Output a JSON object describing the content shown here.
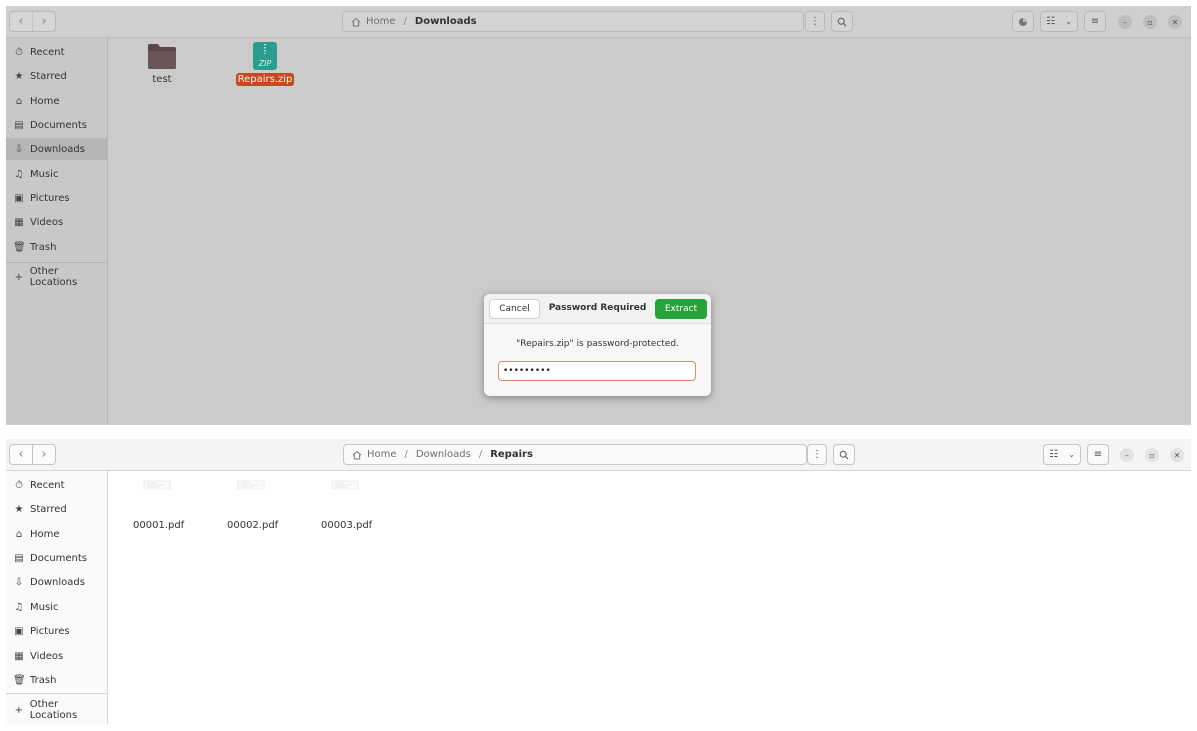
{
  "top_window": {
    "nav": {
      "back": "‹",
      "forward": "›"
    },
    "path": [
      "Home",
      "Downloads"
    ],
    "sidebar": [
      {
        "label": "Recent",
        "icon": "clock-icon",
        "glyph": "⏱"
      },
      {
        "label": "Starred",
        "icon": "star-icon",
        "glyph": "★"
      },
      {
        "label": "Home",
        "icon": "home-icon",
        "glyph": "⌂"
      },
      {
        "label": "Documents",
        "icon": "document-icon",
        "glyph": "▤"
      },
      {
        "label": "Downloads",
        "icon": "download-icon",
        "glyph": "⇩",
        "active": true
      },
      {
        "label": "Music",
        "icon": "music-icon",
        "glyph": "♫"
      },
      {
        "label": "Pictures",
        "icon": "picture-icon",
        "glyph": "▣"
      },
      {
        "label": "Videos",
        "icon": "video-icon",
        "glyph": "▦"
      },
      {
        "label": "Trash",
        "icon": "trash-icon",
        "glyph": "🗑"
      },
      {
        "label": "Other Locations",
        "icon": "plus-icon",
        "glyph": "+"
      }
    ],
    "files": [
      {
        "name": "test",
        "type": "folder"
      },
      {
        "name": "Repairs.zip",
        "type": "zip",
        "selected": true,
        "icon_text": "ZIP"
      }
    ],
    "dialog": {
      "cancel": "Cancel",
      "title": "Password Required",
      "extract": "Extract",
      "message": "\"Repairs.zip\" is password-protected.",
      "password": "•••••••••"
    }
  },
  "bottom_window": {
    "nav": {
      "back": "‹",
      "forward": "›"
    },
    "path": [
      "Home",
      "Downloads",
      "Repairs"
    ],
    "sidebar": [
      {
        "label": "Recent",
        "icon": "clock-icon",
        "glyph": "⏱"
      },
      {
        "label": "Starred",
        "icon": "star-icon",
        "glyph": "★"
      },
      {
        "label": "Home",
        "icon": "home-icon",
        "glyph": "⌂"
      },
      {
        "label": "Documents",
        "icon": "document-icon",
        "glyph": "▤"
      },
      {
        "label": "Downloads",
        "icon": "download-icon",
        "glyph": "⇩"
      },
      {
        "label": "Music",
        "icon": "music-icon",
        "glyph": "♫"
      },
      {
        "label": "Pictures",
        "icon": "picture-icon",
        "glyph": "▣"
      },
      {
        "label": "Videos",
        "icon": "video-icon",
        "glyph": "▦"
      },
      {
        "label": "Trash",
        "icon": "trash-icon",
        "glyph": "🗑"
      },
      {
        "label": "Other Locations",
        "icon": "plus-icon",
        "glyph": "+"
      }
    ],
    "files": [
      {
        "name": "00001.pdf",
        "type": "pdf"
      },
      {
        "name": "00002.pdf",
        "type": "pdf"
      },
      {
        "name": "00003.pdf",
        "type": "pdf"
      }
    ]
  },
  "colors": {
    "accent_selection": "#c5491d",
    "extract_button": "#26a33a",
    "zip_icon": "#2a9d8f",
    "folder_icon": "#5a4548"
  }
}
